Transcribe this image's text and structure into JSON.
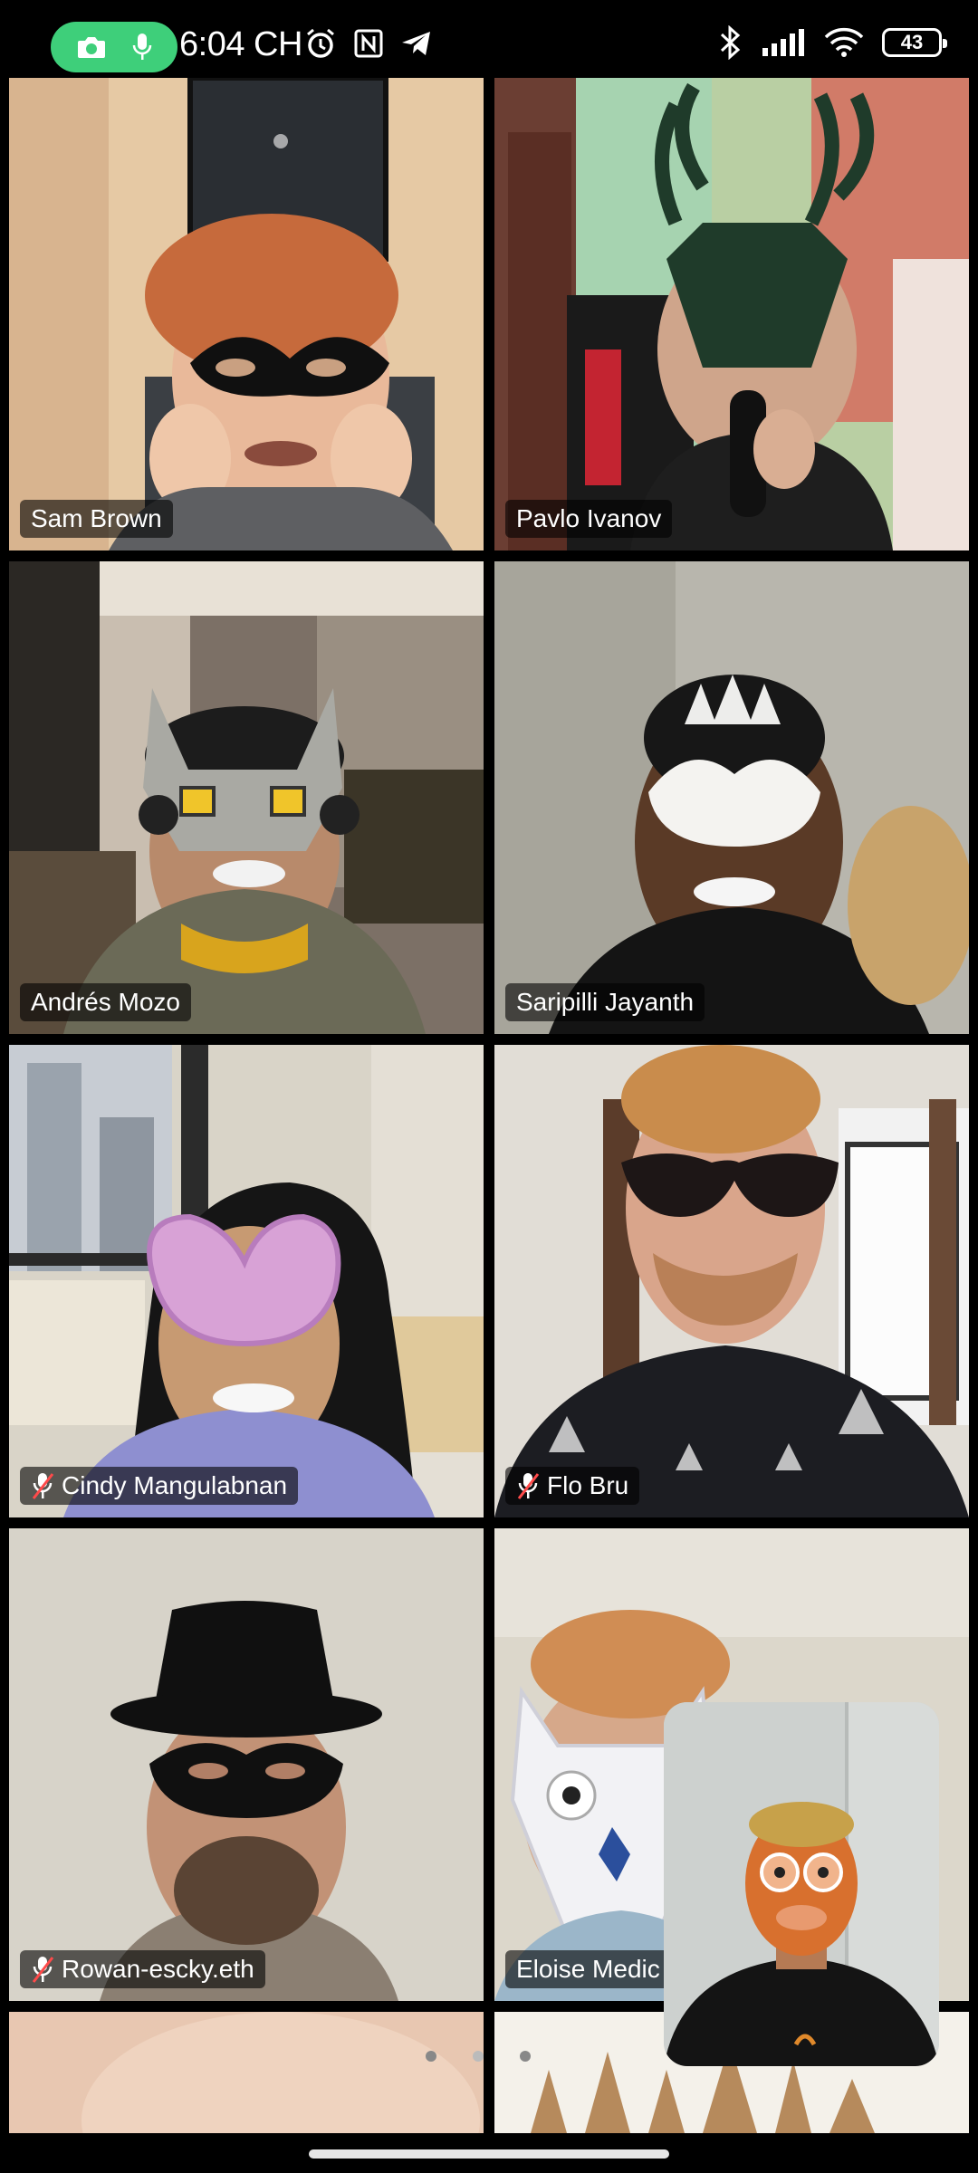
{
  "status_bar": {
    "time": "6:04 CH",
    "battery_level": "43",
    "pill_icons": [
      "camera-icon",
      "microphone-icon"
    ],
    "left_icons": [
      "alarm-icon",
      "nfc-icon",
      "telegram-icon"
    ],
    "right_icons": [
      "bluetooth-icon",
      "cellular-signal-icon",
      "wifi-icon"
    ]
  },
  "participants": [
    {
      "name": "Sam Brown",
      "muted": false,
      "speaking": true
    },
    {
      "name": "Pavlo Ivanov",
      "muted": false,
      "speaking": false
    },
    {
      "name": "Andrés Mozo",
      "muted": false,
      "speaking": false
    },
    {
      "name": "Saripilli Jayanth",
      "muted": false,
      "speaking": false
    },
    {
      "name": "Cindy Mangulabnan",
      "muted": true,
      "speaking": false
    },
    {
      "name": "Flo Bru",
      "muted": true,
      "speaking": false
    },
    {
      "name": "Rowan-escky.eth",
      "muted": true,
      "speaking": false
    },
    {
      "name": "Eloise Medic",
      "muted": false,
      "speaking": false
    }
  ],
  "pagination": {
    "pages": 3,
    "current": 2
  },
  "colors": {
    "active_speaker_border": "#2bd14b",
    "privacy_pill": "#3ecf7a"
  }
}
